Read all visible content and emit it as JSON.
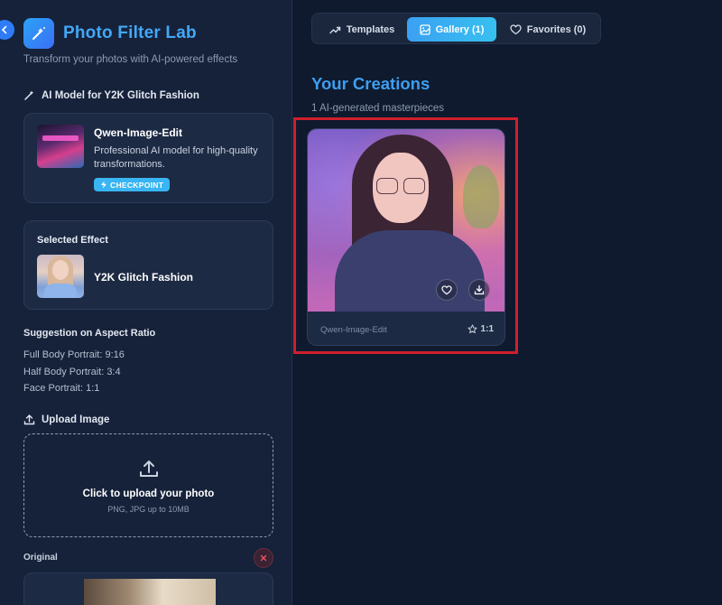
{
  "app": {
    "title": "Photo Filter Lab",
    "subtitle": "Transform your photos with AI-powered effects"
  },
  "sidebar": {
    "model_section_label": "AI Model for Y2K Glitch Fashion",
    "model": {
      "name": "Qwen-Image-Edit",
      "description": "Professional AI model for high-quality transformations.",
      "badge": "CHECKPOINT"
    },
    "effect": {
      "title": "Selected Effect",
      "name": "Y2K Glitch Fashion"
    },
    "aspect": {
      "title": "Suggestion on Aspect Ratio",
      "lines": [
        "Full Body Portrait: 9:16",
        "Half Body Portrait: 3:4",
        "Face Portrait: 1:1"
      ]
    },
    "upload": {
      "label": "Upload Image",
      "main_text": "Click to upload your photo",
      "sub_text": "PNG, JPG up to 10MB"
    },
    "original_label": "Original"
  },
  "tabs": [
    {
      "label": "Templates",
      "icon": "trending-up-icon"
    },
    {
      "label": "Gallery (1)",
      "icon": "image-icon",
      "active": true
    },
    {
      "label": "Favorites (0)",
      "icon": "heart-icon"
    }
  ],
  "gallery": {
    "title": "Your Creations",
    "subtitle": "1 AI-generated masterpieces",
    "items": [
      {
        "model": "Qwen-Image-Edit",
        "ratio": "1:1"
      }
    ]
  },
  "colors": {
    "accent": "#3e9ff0",
    "highlight": "#d01f2c",
    "sidebar_bg": "#16223a",
    "main_bg": "#0f1a2e"
  }
}
